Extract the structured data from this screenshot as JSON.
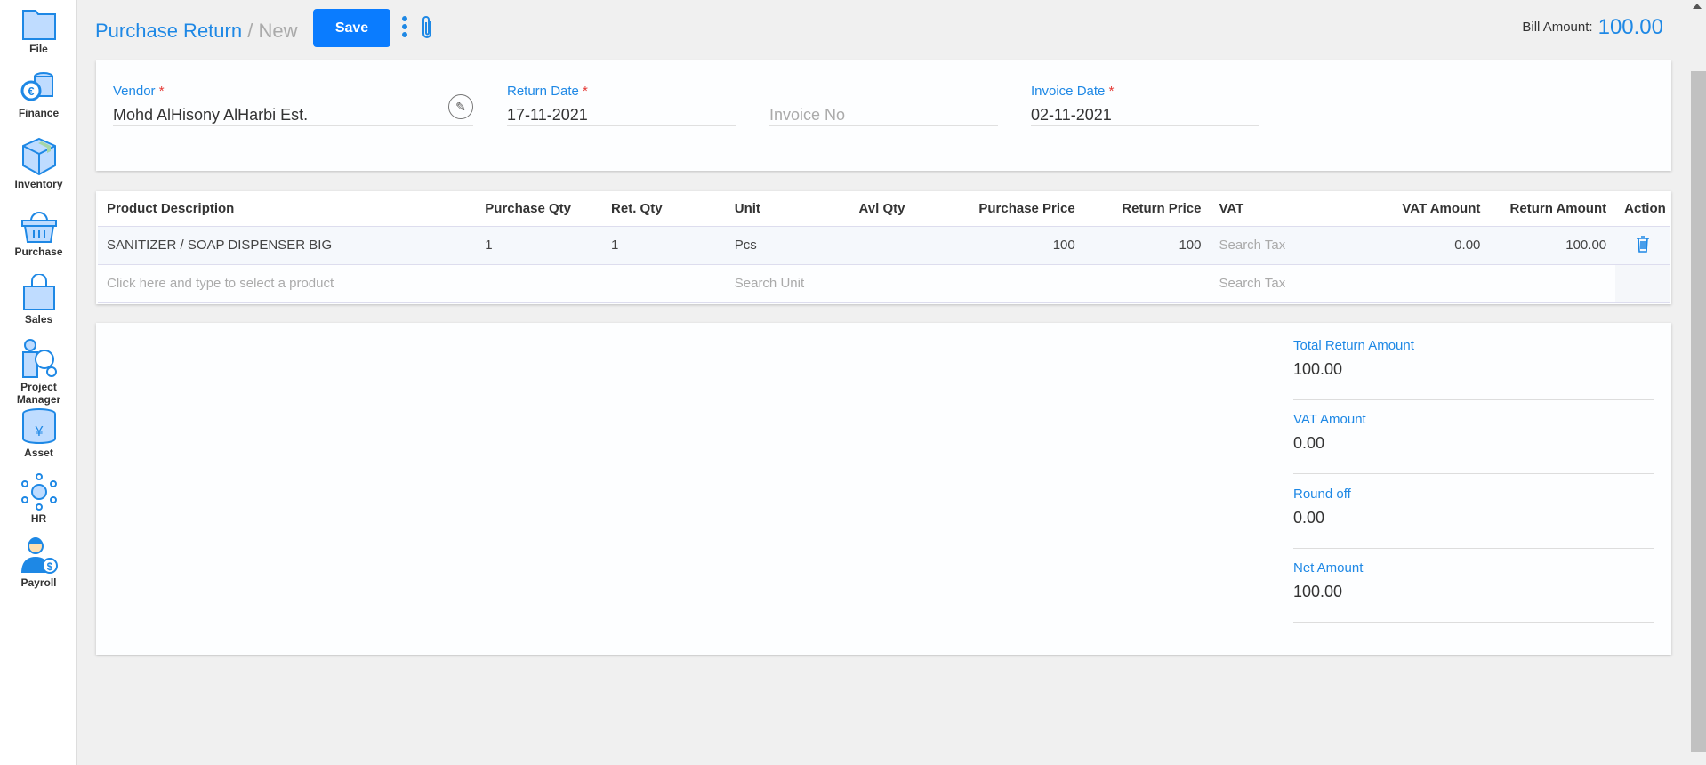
{
  "sidebar": {
    "items": [
      {
        "label": "File",
        "icon": "folder-icon"
      },
      {
        "label": "Finance",
        "icon": "coins-icon"
      },
      {
        "label": "Inventory",
        "icon": "box-icon"
      },
      {
        "label": "Purchase",
        "icon": "basket-icon"
      },
      {
        "label": "Sales",
        "icon": "shopping-bag-icon"
      },
      {
        "label": "Project Manager",
        "icon": "project-icon"
      },
      {
        "label": "Asset",
        "icon": "database-icon"
      },
      {
        "label": "HR",
        "icon": "network-icon"
      },
      {
        "label": "Payroll",
        "icon": "payroll-icon"
      }
    ]
  },
  "header": {
    "title": "Purchase Return",
    "separator": "/",
    "subtitle": "New",
    "save_label": "Save",
    "bill_label": "Bill Amount:",
    "bill_amount": "100.00"
  },
  "form": {
    "vendor": {
      "label": "Vendor",
      "required": "*",
      "value": "Mohd AlHisony AlHarbi Est."
    },
    "return_date": {
      "label": "Return Date",
      "required": "*",
      "value": "17-11-2021"
    },
    "invoice_no": {
      "placeholder": "Invoice No"
    },
    "invoice_date": {
      "label": "Invoice Date",
      "required": "*",
      "value": "02-11-2021"
    }
  },
  "table": {
    "headers": [
      "Product Description",
      "Purchase Qty",
      "Ret. Qty",
      "Unit",
      "Avl Qty",
      "Purchase Price",
      "Return Price",
      "VAT",
      "VAT Amount",
      "Return Amount",
      "Action"
    ],
    "rows": [
      {
        "product": "SANITIZER / SOAP DISPENSER BIG",
        "purchase_qty": "1",
        "ret_qty": "1",
        "unit": "Pcs",
        "avl_qty": "",
        "purchase_price": "100",
        "return_price": "100",
        "vat": "Search Tax",
        "vat_amount": "0.00",
        "return_amount": "100.00"
      }
    ],
    "new_row": {
      "product_placeholder": "Click here and type to select a product",
      "unit_placeholder": "Search Unit",
      "vat_placeholder": "Search Tax"
    }
  },
  "summary": [
    {
      "label": "Total Return Amount",
      "value": "100.00"
    },
    {
      "label": "VAT Amount",
      "value": "0.00"
    },
    {
      "label": "Round off",
      "value": "0.00"
    },
    {
      "label": "Net Amount",
      "value": "100.00"
    }
  ],
  "colors": {
    "accent": "#1e88e5",
    "save": "#0a7cff",
    "required": "#e53935"
  }
}
